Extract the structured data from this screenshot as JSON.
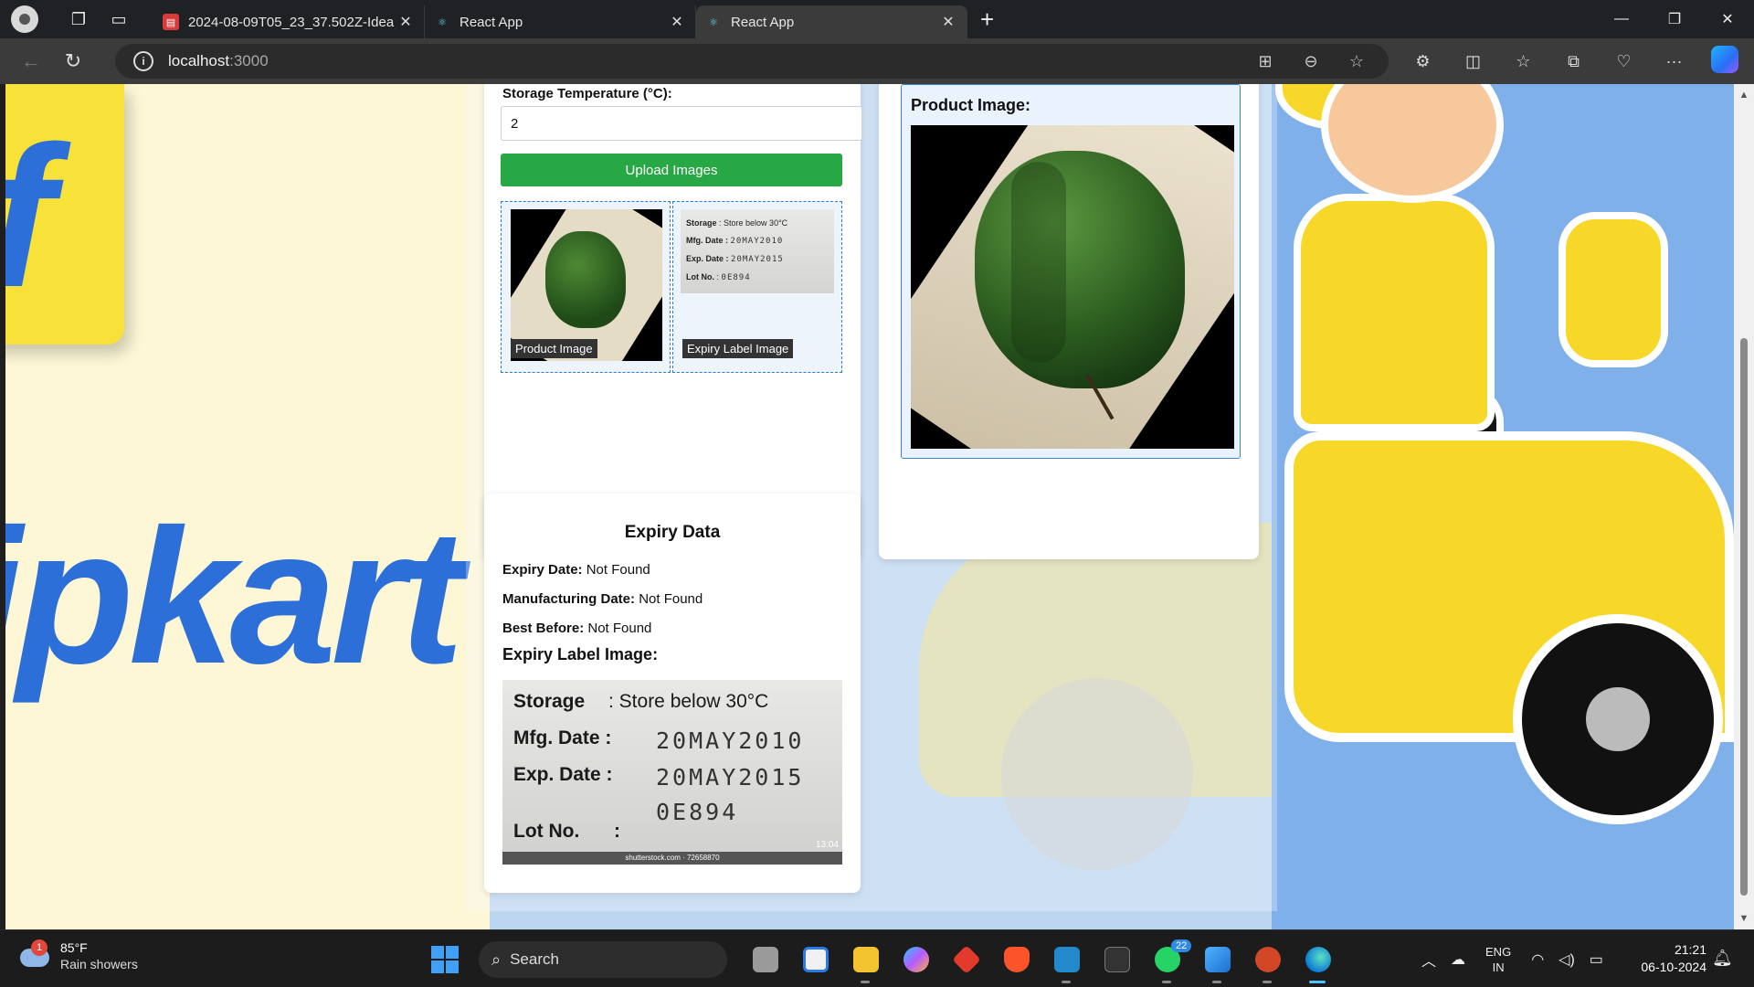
{
  "tabs": [
    {
      "label": "2024-08-09T05_23_37.502Z-Idea",
      "favicon": "pdf-icon"
    },
    {
      "label": "React App",
      "favicon": "react-icon"
    },
    {
      "label": "React App",
      "favicon": "react-icon",
      "active": true
    }
  ],
  "address": {
    "host": "localhost",
    "port": ":3000"
  },
  "form": {
    "temp_label": "Storage Temperature (°C):",
    "temp_value": "2",
    "upload_label": "Upload Images",
    "product_caption": "Product Image",
    "expiry_caption": "Expiry Label Image"
  },
  "product": {
    "title": "Product Image:"
  },
  "expiry": {
    "title": "Expiry Data",
    "expiry_date_key": "Expiry Date:",
    "expiry_date_val": "Not Found",
    "mfg_date_key": "Manufacturing Date:",
    "mfg_date_val": "Not Found",
    "best_before_key": "Best Before:",
    "best_before_val": "Not Found",
    "label_image_title": "Expiry Label Image:"
  },
  "label_image": {
    "storage_key": "Storage",
    "storage_val": ": Store below 30°C",
    "mfg_key": "Mfg. Date :",
    "mfg_val": "20MAY2010",
    "exp_key": "Exp. Date :",
    "exp_val": "20MAY2015",
    "lot_key": "Lot No.",
    "lot_sep": ":",
    "lot_val": "0E894",
    "watermark": "shutterstock.com · 72658870",
    "stamp": "13:04"
  },
  "taskbar": {
    "weather_temp": "85°F",
    "weather_cond": "Rain showers",
    "weather_badge": "1",
    "search_label": "Search",
    "whatsapp_badge": "22",
    "lang_1": "ENG",
    "lang_2": "IN",
    "time": "21:21",
    "date": "06-10-2024"
  },
  "colors": {
    "accent_green": "#28a745",
    "border_blue": "#2b7bd9",
    "brand_blue": "#2c6fd8",
    "brand_yellow": "#f8e23a"
  }
}
